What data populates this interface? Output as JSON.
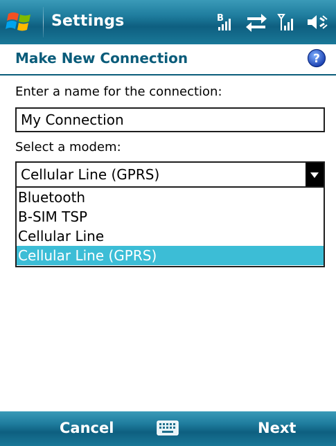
{
  "titlebar": {
    "title": "Settings",
    "status_icons": [
      "bluetooth-signal-icon",
      "data-transfer-icon",
      "signal-strength-icon",
      "speaker-icon"
    ]
  },
  "header": {
    "title": "Make New Connection",
    "help_icon": "help-icon"
  },
  "form": {
    "name_label": "Enter a name for the connection:",
    "name_value": "My Connection",
    "modem_label": "Select a modem:",
    "modem_selected": "Cellular Line (GPRS)",
    "modem_options": [
      {
        "label": "Bluetooth",
        "selected": false
      },
      {
        "label": "B-SIM TSP",
        "selected": false
      },
      {
        "label": "Cellular Line",
        "selected": false
      },
      {
        "label": "Cellular Line (GPRS)",
        "selected": true
      }
    ]
  },
  "softkeys": {
    "left": "Cancel",
    "center_icon": "keyboard-icon",
    "right": "Next"
  },
  "colors": {
    "bar_blue": "#1f7d9e",
    "header_text": "#0a5c7a",
    "selection": "#3cbdd6"
  }
}
